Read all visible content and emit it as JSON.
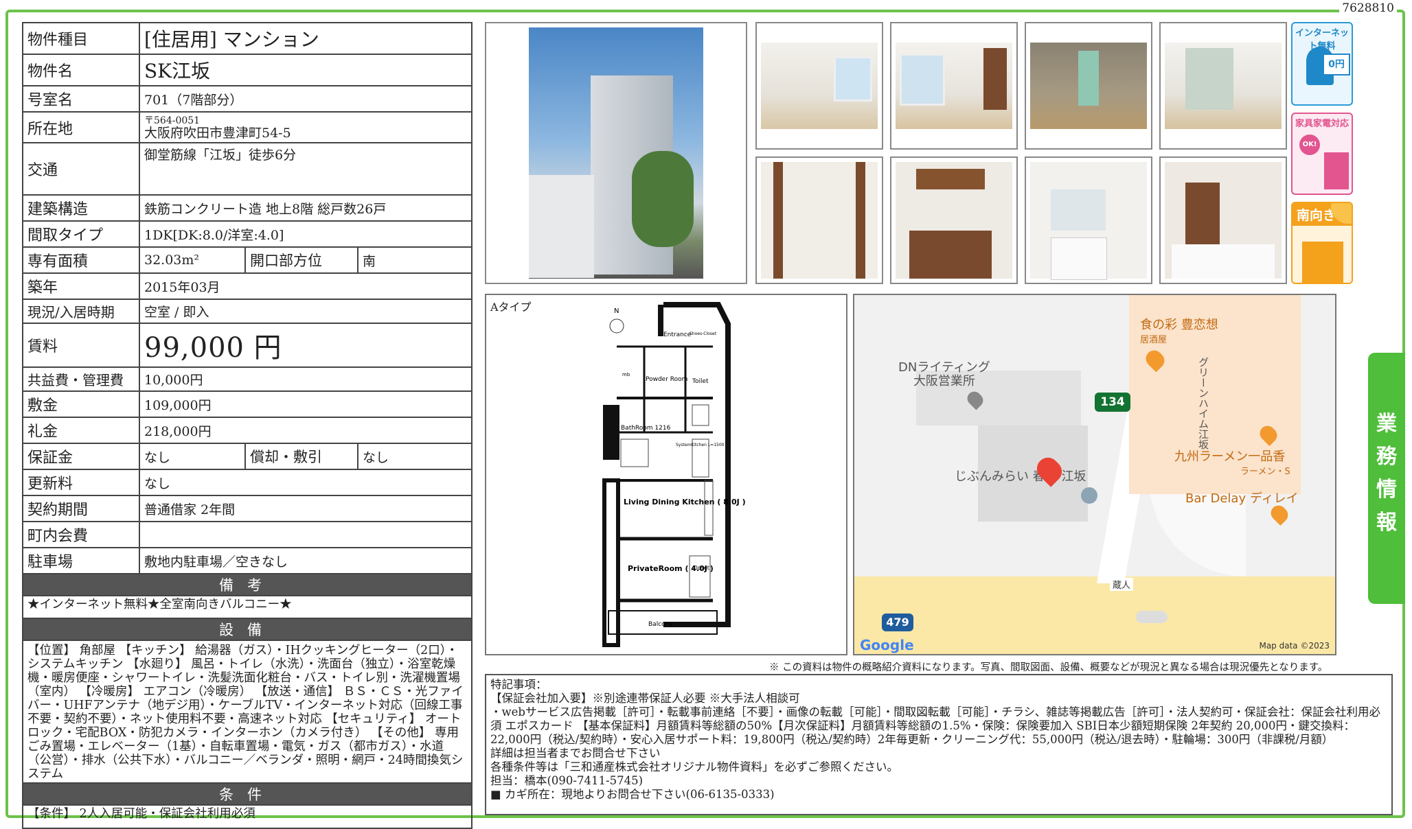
{
  "doc_id": "7628810",
  "spec": {
    "type_label": "物件種目",
    "type_value": "[住居用] マンション",
    "name_label": "物件名",
    "name_value": "SK江坂",
    "room_label": "号室名",
    "room_value": "701（7階部分）",
    "address_label": "所在地",
    "zip": "〒564-0051",
    "address": "大阪府吹田市豊津町54-5",
    "access_label": "交通",
    "access_value": "御堂筋線「江坂」徒歩6分",
    "structure_label": "建築構造",
    "structure_value": "鉄筋コンクリート造 地上8階 総戸数26戸",
    "layout_label": "間取タイプ",
    "layout_value": "1DK[DK:8.0/洋室:4.0]",
    "area_label": "専有面積",
    "area_value": "32.03m²",
    "facing_label": "開口部方位",
    "facing_value": "南",
    "built_label": "築年",
    "built_value": "2015年03月",
    "status_label": "現況/入居時期",
    "status_value": "空室 / 即入",
    "rent_label": "賃料",
    "rent_value": "99,000 円",
    "fee_label": "共益費・管理費",
    "fee_value": "10,000円",
    "deposit_label": "敷金",
    "deposit_value": "109,000円",
    "keymoney_label": "礼金",
    "keymoney_value": "218,000円",
    "guarantee_label": "保証金",
    "guarantee_value": "なし",
    "amort_label": "償却・敷引",
    "amort_value": "なし",
    "renewal_label": "更新料",
    "renewal_value": "なし",
    "contract_label": "契約期間",
    "contract_value": "普通借家 2年間",
    "town_label": "町内会費",
    "town_value": "",
    "parking_label": "駐車場",
    "parking_value": "敷地内駐車場／空きなし",
    "remarks_header": "備考",
    "remarks_text": "★インターネット無料★全室南向きバルコニー★",
    "equipment_header": "設備",
    "equipment_text": "【位置】 角部屋 【キッチン】 給湯器（ガス）・IHクッキングヒーター（2口）・システムキッチン 【水廻り】 風呂・トイレ（水洗）・洗面台（独立）・浴室乾燥機・暖房便座・シャワートイレ・洗髪洗面化粧台・バス・トイレ別・洗濯機置場（室内） 【冷暖房】 エアコン（冷暖房） 【放送・通信】 ＢＳ・ＣＳ・光ファイバー・UHFアンテナ（地デジ用）・ケーブルTV・インターネット対応（回線工事不要・契約不要）・ネット使用料不要・高速ネット対応 【セキュリティ】 オートロック・宅配BOX・防犯カメラ・インターホン（カメラ付き） 【その他】 専用ごみ置場・エレベーター（1基）・自転車置場・電気・ガス（都市ガス）・水道（公営）・排水（公共下水）・バルコニー／ベランダ・照明・網戸・24時間換気システム",
    "conditions_header": "条件",
    "conditions_text": "【条件】 2人入居可能・保証会社利用必須"
  },
  "badges": {
    "internet": "インターネット無料",
    "internet_sub": "0円",
    "furniture": "家具家電対応",
    "furniture_sub": "OK!",
    "south": "南向き"
  },
  "plan": {
    "type_label": "Aタイプ",
    "entrance": "Entrance",
    "shoes": "Shoes-Closet",
    "powder": "Powder Room",
    "toilet": "Toilet",
    "bath": "BathRoom 1216",
    "kitchen": "SystemKitchen L=1500",
    "ldk": "Living Dining Kitchen ( 8.0J )",
    "private": "PrivateRoom ( 4.0J )",
    "closet": "Closet",
    "balcony": "Balcony",
    "north": "N",
    "mb": "mb"
  },
  "map": {
    "poi1": "DNライティング",
    "poi1b": "大阪営業所",
    "poi2": "食の彩 豊恋想",
    "poi2b": "居酒屋",
    "poi3": "グリーンハイム江坂",
    "poi4": "九州ラーメン一品香",
    "poi4b": "ラーメン・S",
    "poi5": "Bar Delay ディレイ",
    "poi6": "じぶんみらい",
    "poi6b": "春園 江坂",
    "route1": "134",
    "route2": "479",
    "street": "蔵人",
    "google": "Google",
    "mapdata": "Map data ©2023"
  },
  "side_tab": "業務情報",
  "disclaimer": "※ この資料は物件の概略紹介資料になります。写真、間取図面、設備、概要などが現況と異なる場合は現況優先となります。",
  "remarks_box": {
    "title": "特記事項：",
    "line1": "【保証会社加入要】※別途連帯保証人必要 ※大手法人相談可",
    "line2": "・webサービス広告掲載［許可］・転載事前連絡［不要］・画像の転載［可能］・間取図転載［可能］・チラシ、雑誌等掲載広告［許可］・法人契約可・保証会社：保証会社利用必須 エポスカード 【基本保証料】月額賃料等総額の50%【月次保証料】月額賃料等総額の1.5%・保険：保険要加入 SBI日本少額短期保険 2年契約 20,000円・鍵交換料：22,000円（税込/契約時）・安心入居サポート料：19,800円（税込/契約時）2年毎更新・クリーニング代：55,000円（税込/退去時）・駐輪場：300円（非課税/月額）",
    "line3": "詳細は担当者までお問合せ下さい",
    "line4": "各種条件等は「三和通産株式会社オリジナル物件資料」を必ずご参照ください。",
    "line5": "担当：橋本(090-7411-5745)",
    "line6": "■ カギ所在：現地よりお問合せ下さい(06-6135-0333)"
  }
}
